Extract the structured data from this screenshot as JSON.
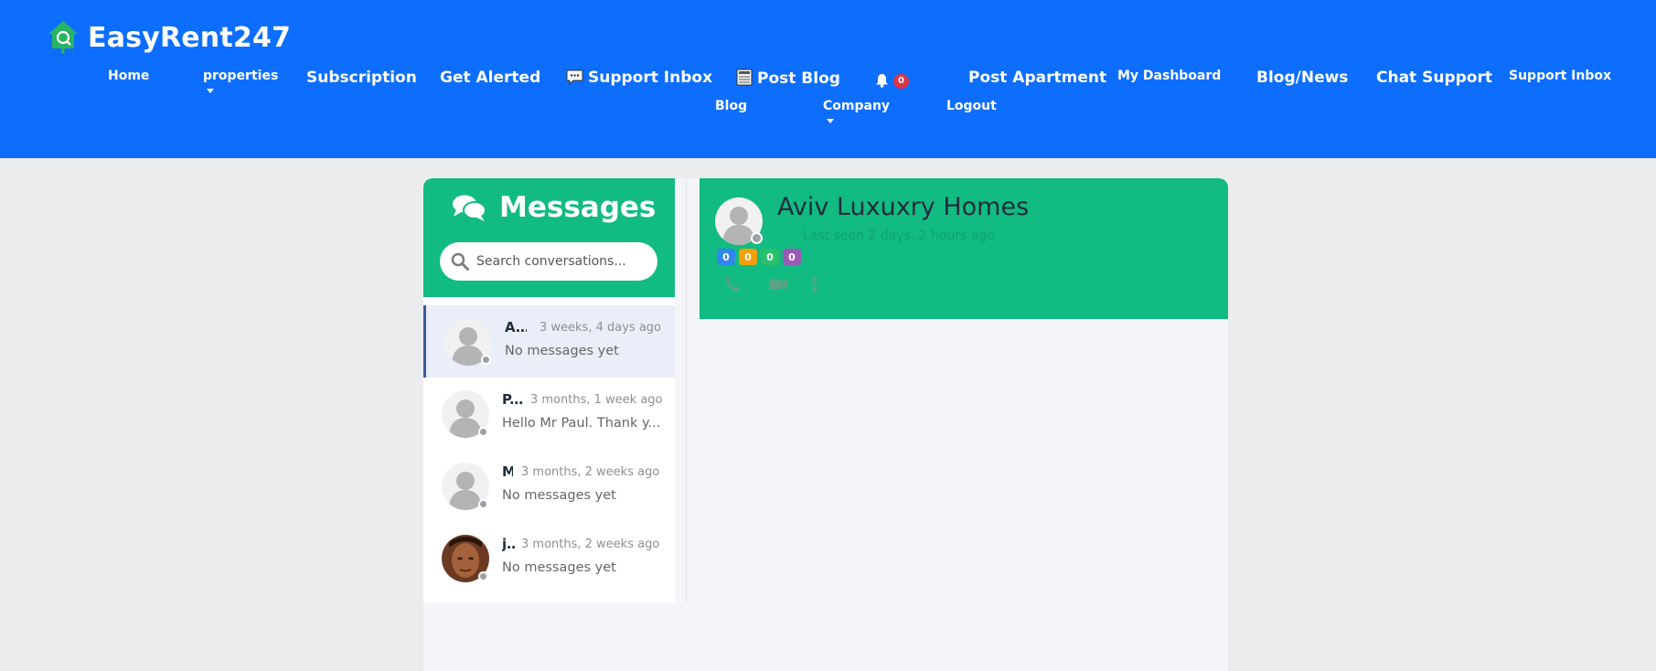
{
  "brand": {
    "name": "EasyRent247"
  },
  "nav": {
    "home": "Home",
    "properties": "properties",
    "subscription": "Subscription",
    "get_alerted": "Get Alerted",
    "support_inbox_chat": "Support Inbox",
    "post_blog": "Post Blog",
    "notification_count": "0",
    "post_apartment": "Post Apartment",
    "my_dashboard": "My Dashboard",
    "blog_news": "Blog/News",
    "chat_support": "Chat Support",
    "support_inbox": "Support Inbox",
    "blog": "Blog",
    "company": "Company",
    "logout": "Logout"
  },
  "sidebar": {
    "title": "Messages",
    "search_placeholder": "Search conversations...",
    "conversations": [
      {
        "name": "A...",
        "time": "3 weeks, 4 days ago",
        "preview": "No messages yet",
        "active": true
      },
      {
        "name": "P...",
        "time": "3 months, 1 week ago",
        "preview": "Hello Mr Paul. Thank y...",
        "active": false
      },
      {
        "name": "M",
        "time": "3 months, 2 weeks ago",
        "preview": "No messages yet",
        "active": false
      },
      {
        "name": "j..",
        "time": "3 months, 2 weeks ago",
        "preview": "No messages yet",
        "active": false
      }
    ]
  },
  "chat": {
    "name": "Aviv Luxuxry Homes",
    "last_seen": "Last seen 2 days, 2 hours ago",
    "counters": [
      {
        "value": "0",
        "color": "#2f86eb"
      },
      {
        "value": "0",
        "color": "#f59f0b"
      },
      {
        "value": "0",
        "color": "#28c06a"
      },
      {
        "value": "0",
        "color": "#9b59b6"
      }
    ],
    "actions": [
      "phone-icon",
      "video-icon",
      "more-vertical-icon"
    ]
  },
  "colors": {
    "header": "#0d6efd",
    "accent": "#12bb81",
    "active_conversation": "#e9eef8"
  }
}
